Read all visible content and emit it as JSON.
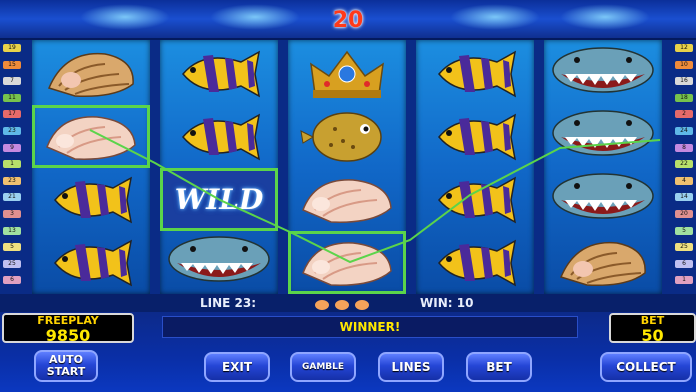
{
  "top": {
    "number": "20"
  },
  "line_markers": {
    "left": [
      "19",
      "15",
      "7",
      "11",
      "17",
      "23",
      "9",
      "1",
      "23",
      "21",
      "3",
      "13",
      "5",
      "25",
      "6"
    ],
    "right": [
      "12",
      "10",
      "16",
      "18",
      "2",
      "24",
      "8",
      "22",
      "4",
      "14",
      "20",
      "5",
      "25",
      "6",
      "1"
    ]
  },
  "reels": [
    [
      "conch-shell",
      "shell-pink",
      "angelfish",
      "angelfish"
    ],
    [
      "angelfish",
      "angelfish",
      "wild",
      "shark"
    ],
    [
      "crown",
      "pufferfish",
      "shell-pink",
      "shell-pink"
    ],
    [
      "angelfish",
      "angelfish",
      "angelfish",
      "angelfish"
    ],
    [
      "shark",
      "shark",
      "shark",
      "conch-shell"
    ]
  ],
  "wild_label": "WILD",
  "info": {
    "line": "LINE 23:",
    "win": "WIN: 10"
  },
  "freeplay": {
    "label": "FREEPLAY",
    "value": "9850"
  },
  "bet": {
    "label": "BET",
    "value": "50"
  },
  "status": "WINNER!",
  "buttons": {
    "auto_start_1": "AUTO",
    "auto_start_2": "START",
    "exit": "EXIT",
    "gamble": "GAMBLE",
    "lines": "LINES",
    "bet": "BET",
    "collect": "COLLECT"
  },
  "colors": {
    "win_line": "#5bd44a",
    "accent": "#ffe800"
  }
}
